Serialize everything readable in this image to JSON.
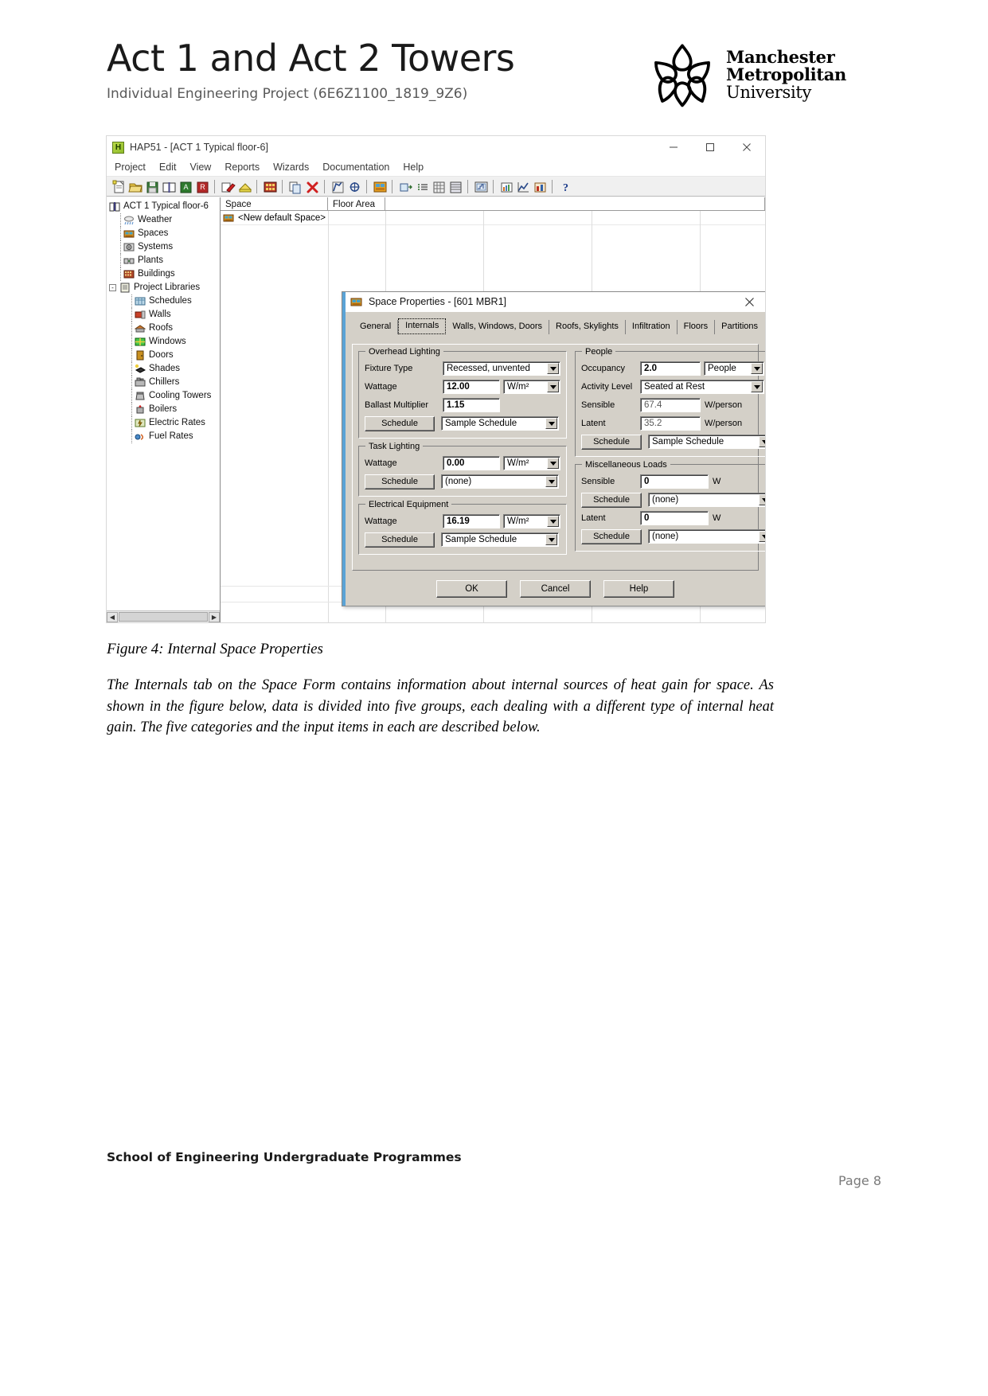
{
  "document": {
    "title": "Act 1 and Act 2 Towers",
    "subtitle": "Individual Engineering Project (6E6Z1100_1819_9Z6)",
    "figure_caption": "Figure 4: Internal Space Properties",
    "body_paragraph": "The Internals tab on the Space Form contains information about internal sources of heat gain for space. As shown in the figure below, data is divided into five groups, each dealing with a different type of internal heat gain. The five categories and the input items in each are described below.",
    "footer_left": "School of Engineering Undergraduate Programmes",
    "footer_right": "Page 8"
  },
  "logo": {
    "line1": "Manchester",
    "line2": "Metropolitan",
    "line3": "University",
    "mark": "mmu-flower-icon"
  },
  "app": {
    "title": "HAP51 - [ACT 1 Typical floor-6]",
    "icon": "hap-app-icon",
    "window_controls": [
      {
        "name": "minimize-button",
        "glyph": "minimize-icon"
      },
      {
        "name": "maximize-button",
        "glyph": "maximize-icon"
      },
      {
        "name": "close-button",
        "glyph": "close-icon"
      }
    ],
    "menu": [
      "Project",
      "Edit",
      "View",
      "Reports",
      "Wizards",
      "Documentation",
      "Help"
    ],
    "toolbar_icons": [
      "new-project-icon",
      "open-project-icon",
      "save-icon",
      "project-library-icon",
      "archive-icon",
      "retrieve-icon",
      "sep",
      "edit-icon",
      "print-preview-icon",
      "sep",
      "weather-icon",
      "sep",
      "copy-icon",
      "delete-icon",
      "sep",
      "properties-icon",
      "view-icon",
      "sep",
      "spaces-icon",
      "sep",
      "input-data-icon",
      "list-icon",
      "table-icon",
      "grid-icon",
      "sep",
      "report-icon",
      "sep",
      "graph-icon",
      "chart-icon",
      "plot-icon",
      "sep",
      "help-icon"
    ],
    "tree": [
      {
        "label": "ACT 1 Typical floor-6",
        "indent": 0,
        "icon": "project-book-icon",
        "expander": ""
      },
      {
        "label": "Weather",
        "indent": 1,
        "icon": "weather-icon",
        "expander": ""
      },
      {
        "label": "Spaces",
        "indent": 1,
        "icon": "spaces-icon",
        "expander": ""
      },
      {
        "label": "Systems",
        "indent": 1,
        "icon": "systems-icon",
        "expander": ""
      },
      {
        "label": "Plants",
        "indent": 1,
        "icon": "plants-icon",
        "expander": ""
      },
      {
        "label": "Buildings",
        "indent": 1,
        "icon": "buildings-icon",
        "expander": ""
      },
      {
        "label": "Project Libraries",
        "indent": 1,
        "icon": "libraries-icon",
        "expander": "-"
      },
      {
        "label": "Schedules",
        "indent": 2,
        "icon": "schedules-icon",
        "expander": ""
      },
      {
        "label": "Walls",
        "indent": 2,
        "icon": "walls-icon",
        "expander": ""
      },
      {
        "label": "Roofs",
        "indent": 2,
        "icon": "roofs-icon",
        "expander": ""
      },
      {
        "label": "Windows",
        "indent": 2,
        "icon": "windows-icon",
        "expander": ""
      },
      {
        "label": "Doors",
        "indent": 2,
        "icon": "doors-icon",
        "expander": ""
      },
      {
        "label": "Shades",
        "indent": 2,
        "icon": "shades-icon",
        "expander": ""
      },
      {
        "label": "Chillers",
        "indent": 2,
        "icon": "chillers-icon",
        "expander": ""
      },
      {
        "label": "Cooling Towers",
        "indent": 2,
        "icon": "cooling-towers-icon",
        "expander": ""
      },
      {
        "label": "Boilers",
        "indent": 2,
        "icon": "boilers-icon",
        "expander": ""
      },
      {
        "label": "Electric Rates",
        "indent": 2,
        "icon": "electric-rates-icon",
        "expander": ""
      },
      {
        "label": "Fuel Rates",
        "indent": 2,
        "icon": "fuel-rates-icon",
        "expander": ""
      }
    ],
    "grid": {
      "columns": [
        "Space",
        "Floor Area"
      ],
      "rows": [
        {
          "label": "<New default Space>",
          "icon": "space-icon"
        }
      ]
    }
  },
  "dialog": {
    "title": "Space Properties - [601 MBR1]",
    "icon": "space-properties-icon",
    "close": "close-icon",
    "tabs": [
      {
        "label": "General",
        "active": false
      },
      {
        "label": "Internals",
        "active": true
      },
      {
        "label": "Walls, Windows, Doors",
        "active": false
      },
      {
        "label": "Roofs, Skylights",
        "active": false
      },
      {
        "label": "Infiltration",
        "active": false
      },
      {
        "label": "Floors",
        "active": false
      },
      {
        "label": "Partitions",
        "active": false
      }
    ],
    "groups": {
      "overhead_lighting": {
        "title": "Overhead Lighting",
        "fixture_type_label": "Fixture Type",
        "fixture_type_value": "Recessed, unvented",
        "wattage_label": "Wattage",
        "wattage_value": "12.00",
        "wattage_unit": "W/m²",
        "ballast_label": "Ballast Multiplier",
        "ballast_value": "1.15",
        "schedule_button": "Schedule",
        "schedule_value": "Sample Schedule"
      },
      "task_lighting": {
        "title": "Task Lighting",
        "wattage_label": "Wattage",
        "wattage_value": "0.00",
        "wattage_unit": "W/m²",
        "schedule_button": "Schedule",
        "schedule_value": "(none)"
      },
      "electrical_equipment": {
        "title": "Electrical Equipment",
        "wattage_label": "Wattage",
        "wattage_value": "16.19",
        "wattage_unit": "W/m²",
        "schedule_button": "Schedule",
        "schedule_value": "Sample Schedule"
      },
      "people": {
        "title": "People",
        "occupancy_label": "Occupancy",
        "occupancy_value": "2.0",
        "occupancy_unit": "People",
        "activity_label": "Activity Level",
        "activity_value": "Seated at Rest",
        "sensible_label": "Sensible",
        "sensible_value": "67.4",
        "sensible_unit": "W/person",
        "latent_label": "Latent",
        "latent_value": "35.2",
        "latent_unit": "W/person",
        "schedule_button": "Schedule",
        "schedule_value": "Sample Schedule"
      },
      "miscellaneous_loads": {
        "title": "Miscellaneous Loads",
        "sensible_label": "Sensible",
        "sensible_value": "0",
        "sensible_unit": "W",
        "sensible_schedule_button": "Schedule",
        "sensible_schedule_value": "(none)",
        "latent_label": "Latent",
        "latent_value": "0",
        "latent_unit": "W",
        "latent_schedule_button": "Schedule",
        "latent_schedule_value": "(none)"
      }
    },
    "buttons": {
      "ok": "OK",
      "cancel": "Cancel",
      "help": "Help"
    }
  },
  "colors": {
    "dialog_face": "#d4d0c8",
    "accent_blue": "#5aa3d6",
    "app_icon_green": "#8fbc2a",
    "subtitle_gray": "#595959",
    "page_number_gray": "#7a7a7a"
  }
}
